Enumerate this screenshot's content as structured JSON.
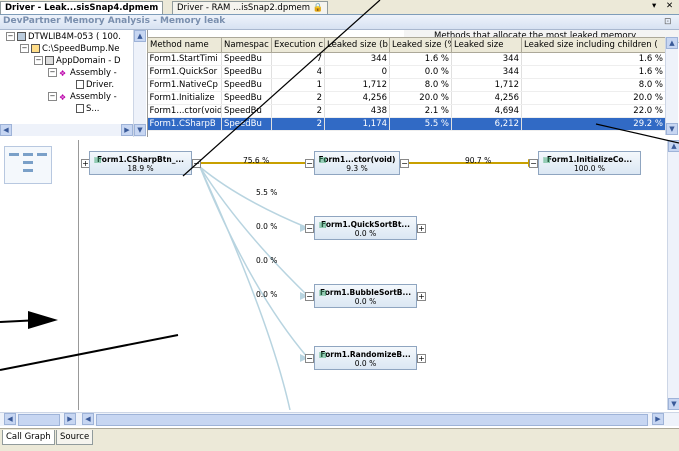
{
  "doc_tabs": [
    {
      "label": "Driver - Leak...sisSnap4.dpmem",
      "active": true
    },
    {
      "label": "Driver - RAM ...isSnap2.dpmem",
      "active": false
    }
  ],
  "window_controls": {
    "dropdown": "▾",
    "close": "✕"
  },
  "title": "DevPartner Memory Analysis - Memory leak",
  "methods_header": "Methods that allocate the most leaked memory",
  "tree": [
    {
      "label": "DTWLIB4M-053 ( 100.",
      "indent": 0,
      "box": "⊟"
    },
    {
      "label": "C:\\SpeedBump.Ne",
      "indent": 1,
      "box": "⊟"
    },
    {
      "label": "AppDomain - D",
      "indent": 2,
      "box": "⊟"
    },
    {
      "label": "Assembly -",
      "indent": 3,
      "box": "⊟"
    },
    {
      "label": "Driver.",
      "indent": 4,
      "box": ""
    },
    {
      "label": "Assembly -",
      "indent": 3,
      "box": "⊟"
    },
    {
      "label": "S...",
      "indent": 4,
      "box": ""
    }
  ],
  "grid": {
    "columns": [
      "Method name",
      "Namespac",
      "Execution c",
      "Leaked size (b",
      "Leaked size (%",
      "Leaked size",
      "Leaked size including children ("
    ],
    "rows": [
      [
        "Form1.StartTimi",
        "SpeedBu",
        "7",
        "344",
        "1.6 %",
        "344",
        "1.6 %"
      ],
      [
        "Form1.QuickSor",
        "SpeedBu",
        "4",
        "0",
        "0.0 %",
        "344",
        "1.6 %"
      ],
      [
        "Form1.NativeCp",
        "SpeedBu",
        "1",
        "1,712",
        "8.0 %",
        "1,712",
        "8.0 %"
      ],
      [
        "Form1.Initialize",
        "SpeedBu",
        "2",
        "4,256",
        "20.0 %",
        "4,256",
        "20.0 %"
      ],
      [
        "Form1...ctor(void",
        "SpeedBu",
        "2",
        "438",
        "2.1 %",
        "4,694",
        "22.0 %"
      ],
      [
        "Form1.CSharpB",
        "SpeedBu",
        "2",
        "1,174",
        "5.5 %",
        "6,212",
        "29.2 %"
      ]
    ],
    "selected_row": 5
  },
  "graph": {
    "root": {
      "name": "Form1.CSharpBtn_...",
      "pct": "18.9 %"
    },
    "nodes": [
      {
        "name": "Form1...ctor(void)",
        "pct": "9.3 %"
      },
      {
        "name": "Form1.InitializeCo...",
        "pct": "100.0 %"
      },
      {
        "name": "Form1.QuickSortBt...",
        "pct": "0.0 %"
      },
      {
        "name": "Form1.BubbleSortB...",
        "pct": "0.0 %"
      },
      {
        "name": "Form1.RandomizeB...",
        "pct": "0.0 %"
      }
    ],
    "edge_labels": [
      "75.6 %",
      "90.7 %",
      "5.5 %",
      "0.0 %",
      "0.0 %",
      "0.0 %"
    ]
  },
  "bottom_tabs": [
    {
      "label": "Call Graph",
      "active": true
    },
    {
      "label": "Source",
      "active": false
    }
  ],
  "colors": {
    "selection": "#316ac5",
    "edge_main": "#c8a000",
    "edge_light": "#b8d4e0",
    "title_text": "#7a8fae"
  }
}
